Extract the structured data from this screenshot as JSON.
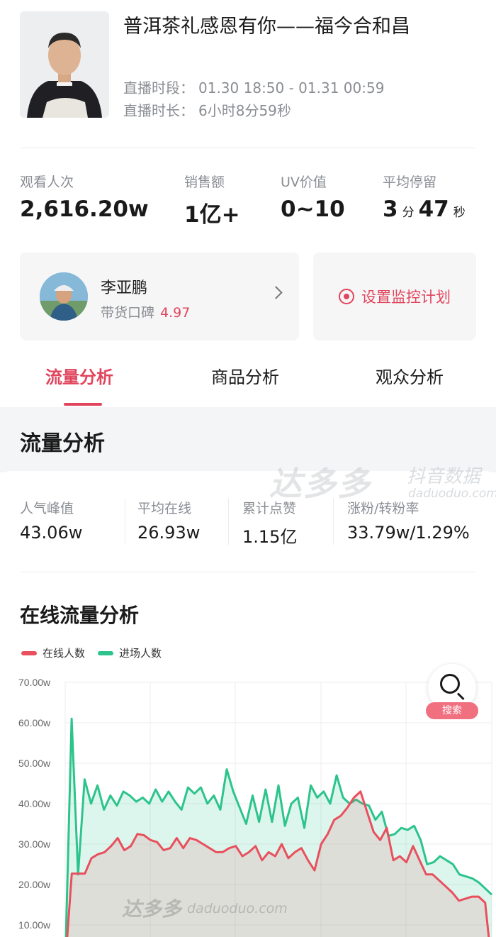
{
  "header": {
    "title": "普洱茶礼感恩有你——福今合和昌",
    "time_range_label": "直播时段：",
    "time_range_value": "01.30 18:50 - 01.31 00:59",
    "duration_label": "直播时长：",
    "duration_value": "6小时8分59秒"
  },
  "stats": [
    {
      "label": "观看人次",
      "value": "2,616.20w"
    },
    {
      "label": "销售额",
      "value": "1亿+"
    },
    {
      "label": "UV价值",
      "value": "0~10"
    },
    {
      "label": "平均停留",
      "value_min": "3",
      "unit_min": "分",
      "value_sec": "47",
      "unit_sec": "秒"
    }
  ],
  "anchor": {
    "name": "李亚鹏",
    "rating_label": "带货口碑",
    "rating": "4.97"
  },
  "monitor_button": "设置监控计划",
  "tabs": [
    {
      "label": "流量分析",
      "active": true
    },
    {
      "label": "商品分析",
      "active": false
    },
    {
      "label": "观众分析",
      "active": false
    }
  ],
  "section_title": "流量分析",
  "watermark": {
    "brand": "达多多",
    "sub": "抖音数据",
    "url": "daduoduo.com"
  },
  "traffic_stats": [
    {
      "label": "人气峰值",
      "value": "43.06w"
    },
    {
      "label": "平均在线",
      "value": "26.93w"
    },
    {
      "label": "累计点赞",
      "value": "1.15亿"
    },
    {
      "label": "涨粉/转粉率",
      "value": "33.79w/1.29%"
    }
  ],
  "chart_title": "在线流量分析",
  "search_badge": "搜索",
  "colors": {
    "accent": "#e1455d",
    "online": "#e8505e",
    "entry": "#2cc48c"
  },
  "chart_data": {
    "type": "area",
    "title": "",
    "ylim": [
      0,
      70
    ],
    "yticks": [
      "10.00w",
      "20.00w",
      "30.00w",
      "40.00w",
      "50.00w",
      "60.00w",
      "70.00w"
    ],
    "ytick_values": [
      10,
      20,
      30,
      40,
      50,
      60,
      70
    ],
    "grid": true,
    "legend": "top-left",
    "series": [
      {
        "name": "在线人数",
        "color": "#e8505e",
        "values": [
          0,
          22.7,
          22.7,
          22.7,
          26.5,
          27.5,
          28,
          29.5,
          31.5,
          28.5,
          29.5,
          32.5,
          32.2,
          31,
          30.5,
          28.5,
          29,
          31.5,
          29,
          31.5,
          31,
          30,
          29,
          28,
          28,
          29,
          29.5,
          27,
          28,
          29.5,
          26,
          28,
          27,
          30,
          26.5,
          28,
          29,
          26,
          23.5,
          30,
          32.5,
          36,
          37,
          39,
          41.5,
          43,
          38,
          33,
          31,
          34,
          26,
          27,
          25.5,
          29.5,
          26,
          22.5,
          22.5,
          21,
          19.5,
          18,
          16,
          16.5,
          17,
          17,
          15.5,
          0
        ]
      },
      {
        "name": "进场人数",
        "color": "#2cc48c",
        "values": [
          0,
          61,
          22.5,
          46,
          40,
          44.5,
          38.5,
          42,
          39.5,
          43,
          42,
          40.5,
          41.5,
          40,
          43.5,
          40.5,
          43,
          40.5,
          38.5,
          44,
          42.5,
          44,
          40,
          42,
          38.5,
          48.5,
          43,
          39,
          35,
          42,
          35.5,
          43.5,
          35.5,
          44.5,
          34.5,
          40,
          41.5,
          34,
          44.5,
          41.5,
          43,
          40,
          47,
          41.5,
          40,
          41,
          40,
          39.5,
          36,
          38,
          32,
          32.5,
          34,
          33.5,
          34.5,
          31,
          25,
          25.5,
          27,
          26,
          25,
          22.5,
          22,
          21.5,
          20.5,
          19,
          17.5
        ]
      }
    ]
  }
}
